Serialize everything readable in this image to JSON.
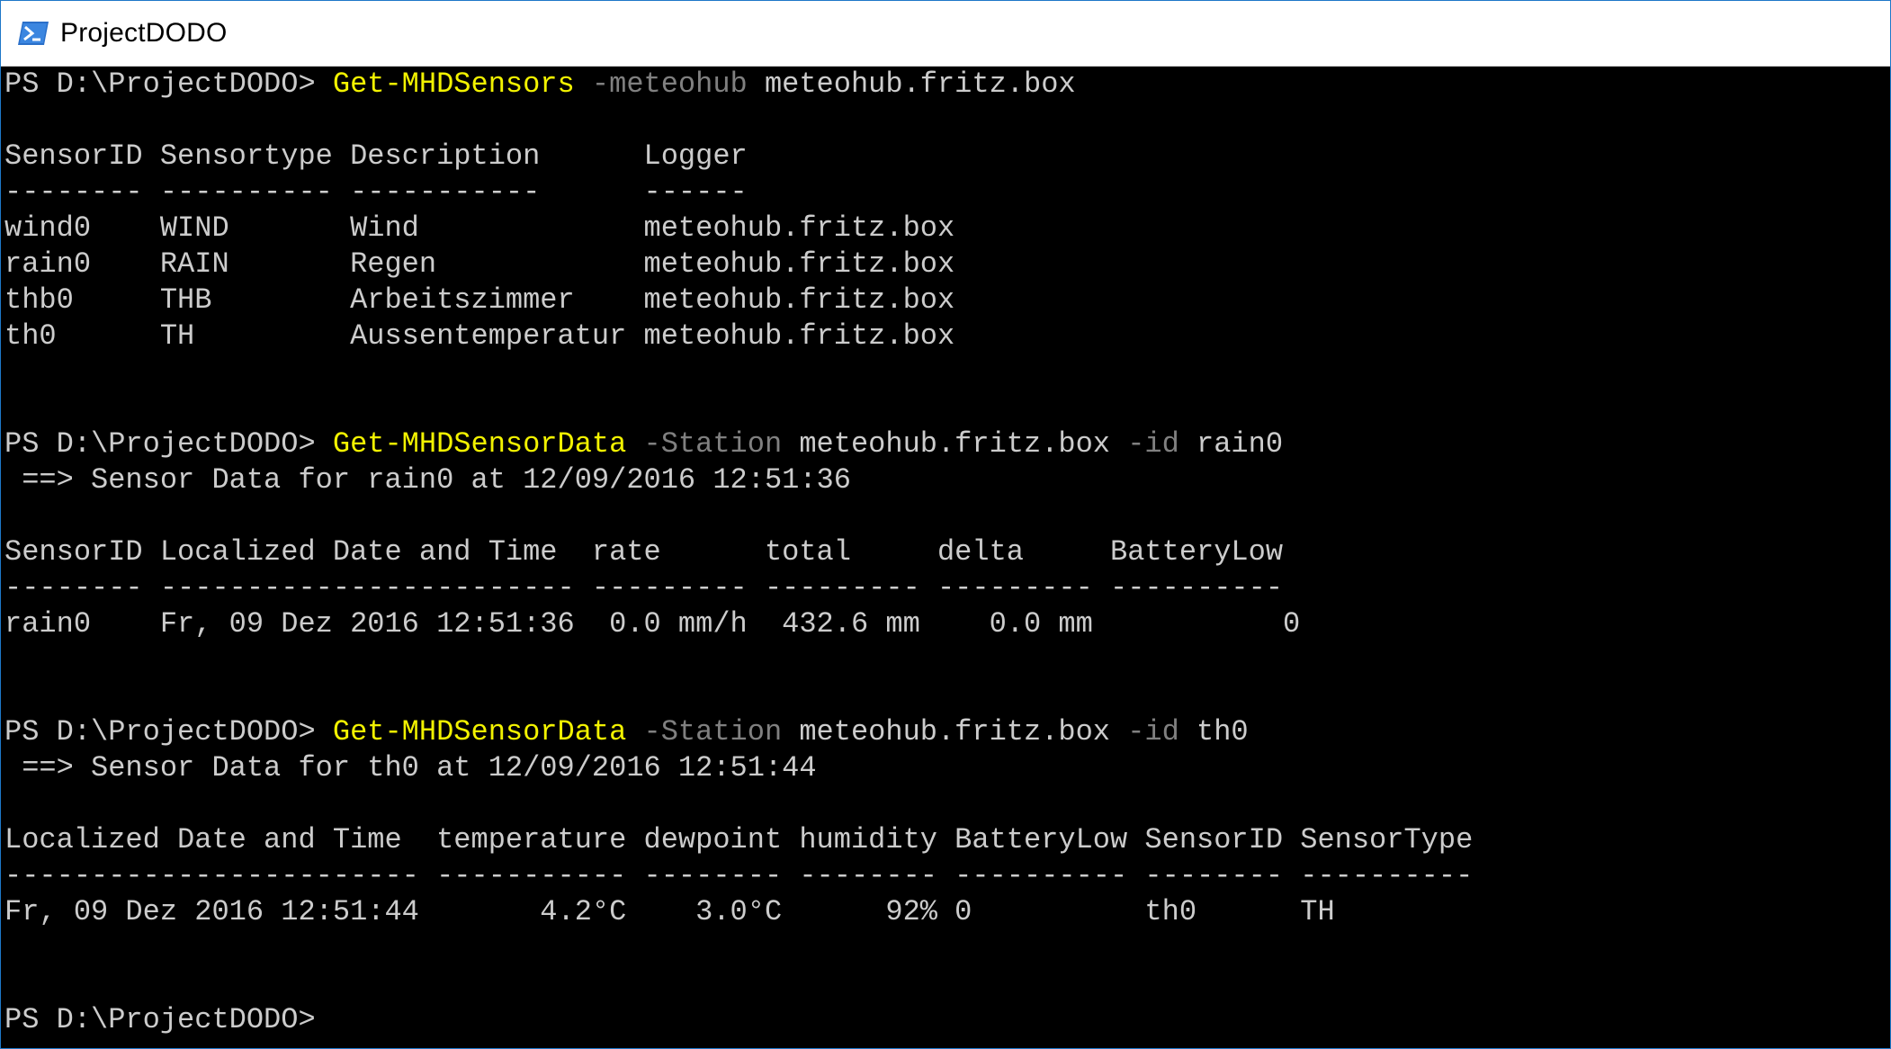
{
  "window": {
    "title": "ProjectDODO",
    "icon": "powershell-icon"
  },
  "colors": {
    "console_bg": "#000000",
    "console_text": "#cccccc",
    "cmdlet": "#f2f200",
    "parameter": "#808080"
  },
  "console": {
    "lines": [
      {
        "segments": [
          {
            "t": "PS D:\\ProjectDODO> ",
            "s": "plain"
          },
          {
            "t": "Get-MHDSensors",
            "s": "cmd"
          },
          {
            "t": " -meteohub",
            "s": "param"
          },
          {
            "t": " meteohub.fritz.box",
            "s": "plain"
          }
        ]
      },
      {
        "segments": []
      },
      {
        "segments": [
          {
            "t": "SensorID Sensortype Description      Logger",
            "s": "plain"
          }
        ]
      },
      {
        "segments": [
          {
            "t": "-------- ---------- -----------      ------",
            "s": "plain"
          }
        ]
      },
      {
        "segments": [
          {
            "t": "wind0    WIND       Wind             meteohub.fritz.box",
            "s": "plain"
          }
        ]
      },
      {
        "segments": [
          {
            "t": "rain0    RAIN       Regen            meteohub.fritz.box",
            "s": "plain"
          }
        ]
      },
      {
        "segments": [
          {
            "t": "thb0     THB        Arbeitszimmer    meteohub.fritz.box",
            "s": "plain"
          }
        ]
      },
      {
        "segments": [
          {
            "t": "th0      TH         Aussentemperatur meteohub.fritz.box",
            "s": "plain"
          }
        ]
      },
      {
        "segments": []
      },
      {
        "segments": []
      },
      {
        "segments": [
          {
            "t": "PS D:\\ProjectDODO> ",
            "s": "plain"
          },
          {
            "t": "Get-MHDSensorData",
            "s": "cmd"
          },
          {
            "t": " -Station",
            "s": "param"
          },
          {
            "t": " meteohub.fritz.box",
            "s": "plain"
          },
          {
            "t": " -id",
            "s": "param"
          },
          {
            "t": " rain0",
            "s": "plain"
          }
        ]
      },
      {
        "segments": [
          {
            "t": " ==> Sensor Data for rain0 at 12/09/2016 12:51:36",
            "s": "plain"
          }
        ]
      },
      {
        "segments": []
      },
      {
        "segments": [
          {
            "t": "SensorID Localized Date and Time  rate      total     delta     BatteryLow",
            "s": "plain"
          }
        ]
      },
      {
        "segments": [
          {
            "t": "-------- ------------------------ --------- --------- --------- ----------",
            "s": "plain"
          }
        ]
      },
      {
        "segments": [
          {
            "t": "rain0    Fr, 09 Dez 2016 12:51:36  0.0 mm/h  432.6 mm    0.0 mm           0",
            "s": "plain"
          }
        ]
      },
      {
        "segments": []
      },
      {
        "segments": []
      },
      {
        "segments": [
          {
            "t": "PS D:\\ProjectDODO> ",
            "s": "plain"
          },
          {
            "t": "Get-MHDSensorData",
            "s": "cmd"
          },
          {
            "t": " -Station",
            "s": "param"
          },
          {
            "t": " meteohub.fritz.box",
            "s": "plain"
          },
          {
            "t": " -id",
            "s": "param"
          },
          {
            "t": " th0",
            "s": "plain"
          }
        ]
      },
      {
        "segments": [
          {
            "t": " ==> Sensor Data for th0 at 12/09/2016 12:51:44",
            "s": "plain"
          }
        ]
      },
      {
        "segments": []
      },
      {
        "segments": [
          {
            "t": "Localized Date and Time  temperature dewpoint humidity BatteryLow SensorID SensorType",
            "s": "plain"
          }
        ]
      },
      {
        "segments": [
          {
            "t": "------------------------ ----------- -------- -------- ---------- -------- ----------",
            "s": "plain"
          }
        ]
      },
      {
        "segments": [
          {
            "t": "Fr, 09 Dez 2016 12:51:44       4.2°C    3.0°C      92% 0          th0      TH",
            "s": "plain"
          }
        ]
      },
      {
        "segments": []
      },
      {
        "segments": []
      },
      {
        "segments": [
          {
            "t": "PS D:\\ProjectDODO> ",
            "s": "plain"
          }
        ]
      }
    ]
  }
}
